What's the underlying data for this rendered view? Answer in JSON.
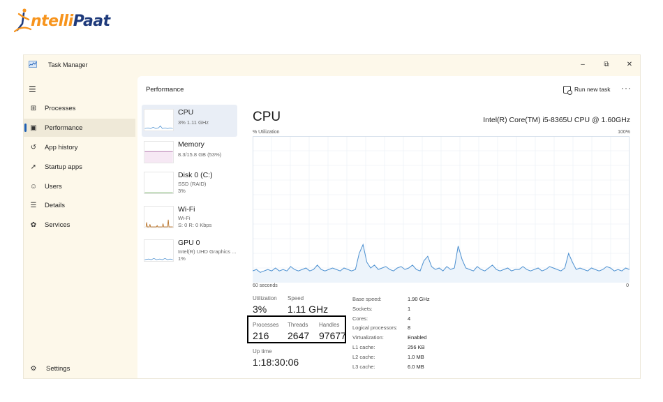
{
  "brand": {
    "prefix": "ntelli",
    "suffix": "Paat"
  },
  "window": {
    "title": "Task Manager",
    "controls": {
      "minimize": "–",
      "restore": "⧉",
      "close": "✕"
    }
  },
  "sidebar": {
    "items": [
      {
        "label": "Processes",
        "icon": "processes-icon",
        "glyph": "⊞"
      },
      {
        "label": "Performance",
        "icon": "performance-icon",
        "glyph": "▣",
        "active": true
      },
      {
        "label": "App history",
        "icon": "app-history-icon",
        "glyph": "↺"
      },
      {
        "label": "Startup apps",
        "icon": "startup-apps-icon",
        "glyph": "➚"
      },
      {
        "label": "Users",
        "icon": "users-icon",
        "glyph": "☺"
      },
      {
        "label": "Details",
        "icon": "details-icon",
        "glyph": "☰"
      },
      {
        "label": "Services",
        "icon": "services-icon",
        "glyph": "✿"
      }
    ],
    "settings": {
      "label": "Settings",
      "glyph": "⚙"
    }
  },
  "header": {
    "title": "Performance",
    "run_task": "Run new task",
    "more": "···"
  },
  "resources": [
    {
      "name": "CPU",
      "sub": "3% 1.11 GHz",
      "sub2": ""
    },
    {
      "name": "Memory",
      "sub": "8.3/15.8 GB (53%)",
      "sub2": ""
    },
    {
      "name": "Disk 0 (C:)",
      "sub": "SSD (RAID)",
      "sub2": "3%"
    },
    {
      "name": "Wi-Fi",
      "sub": "Wi-Fi",
      "sub2": "S: 0 R: 0 Kbps"
    },
    {
      "name": "GPU 0",
      "sub": "Intel(R) UHD Graphics ...",
      "sub2": "1%"
    }
  ],
  "cpu": {
    "title": "CPU",
    "model": "Intel(R) Core(TM) i5-8365U CPU @ 1.60GHz",
    "util_label": "% Utilization",
    "util_max": "100%",
    "time_left": "60 seconds",
    "time_right": "0",
    "graph": [
      92,
      91,
      93,
      92,
      91,
      92,
      90,
      92,
      91,
      92,
      89,
      91,
      92,
      91,
      90,
      92,
      91,
      88,
      91,
      92,
      91,
      90,
      91,
      92,
      90,
      91,
      92,
      91,
      80,
      74,
      86,
      90,
      88,
      91,
      90,
      89,
      91,
      92,
      90,
      89,
      91,
      90,
      88,
      91,
      92,
      85,
      82,
      89,
      91,
      90,
      92,
      89,
      91,
      90,
      75,
      84,
      90,
      91,
      92,
      89,
      91,
      92,
      90,
      88,
      91,
      92,
      91,
      90,
      92,
      91,
      91,
      89,
      91,
      92,
      91,
      90,
      92,
      91,
      89,
      90,
      91,
      92,
      90,
      80,
      86,
      91,
      90,
      91,
      92,
      90,
      91,
      92,
      91,
      89,
      90,
      92,
      91,
      92,
      90,
      91
    ],
    "stats": {
      "utilization": {
        "label": "Utilization",
        "value": "3%"
      },
      "speed": {
        "label": "Speed",
        "value": "1.11 GHz"
      },
      "processes": {
        "label": "Processes",
        "value": "216"
      },
      "threads": {
        "label": "Threads",
        "value": "2647"
      },
      "handles": {
        "label": "Handles",
        "value": "97677"
      },
      "uptime": {
        "label": "Up time",
        "value": "1:18:30:06"
      }
    },
    "specs": [
      {
        "k": "Base speed:",
        "v": "1.90 GHz"
      },
      {
        "k": "Sockets:",
        "v": "1"
      },
      {
        "k": "Cores:",
        "v": "4"
      },
      {
        "k": "Logical processors:",
        "v": "8"
      },
      {
        "k": "Virtualization:",
        "v": "Enabled"
      },
      {
        "k": "L1 cache:",
        "v": "256 KB"
      },
      {
        "k": "L2 cache:",
        "v": "1.0 MB"
      },
      {
        "k": "L3 cache:",
        "v": "6.0 MB"
      }
    ]
  },
  "colors": {
    "accent": "#1e5fb4",
    "graph_line": "#4a8fd0",
    "graph_fill": "#edf4fb",
    "grid": "#e8eef5",
    "memory": "#9b4f96"
  }
}
